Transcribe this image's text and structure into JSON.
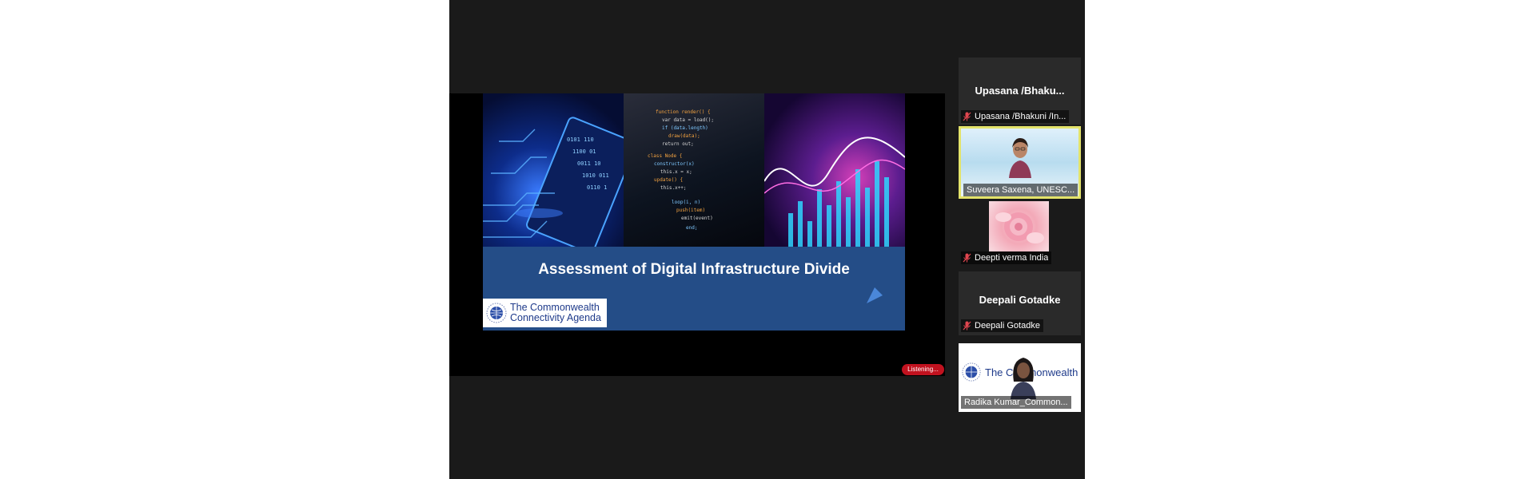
{
  "share": {
    "slide_title": "Assessment of Digital Infrastructure Divide",
    "logo_line1": "The Commonwealth",
    "logo_line2": "Connectivity Agenda",
    "listening_badge": "Listening..."
  },
  "gallery": {
    "tiles": [
      {
        "name_display": "Upasana  /Bhaku...",
        "label": "Upasana /Bhakuni /In...",
        "muted": true
      },
      {
        "label": "Suveera Saxena, UNESC...",
        "active_speaker": true,
        "muted": false
      },
      {
        "label": "Deepti verma India",
        "muted": true
      },
      {
        "name_display": "Deepali Gotadke",
        "label": "Deepali Gotadke",
        "muted": true
      },
      {
        "label": "Radika Kumar_Common...",
        "background_text": "The Commonwealth",
        "muted": false
      }
    ]
  },
  "colors": {
    "window_bg": "#1a1a1a",
    "slide_blue": "#244d87",
    "active_speaker_border": "#e3e36a",
    "listening_red": "#c1121f",
    "muted_mic_red": "#e0464f"
  },
  "icons": [
    "globe-logo-icon",
    "muted-mic-icon"
  ]
}
